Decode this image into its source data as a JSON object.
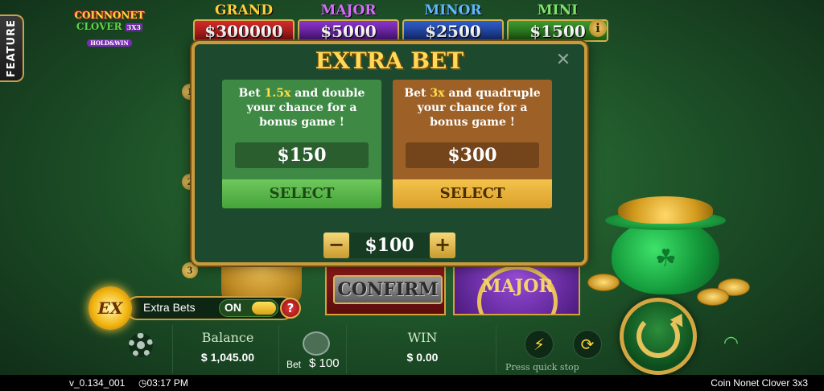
{
  "sidebar": {
    "feature_label": "FEATURE"
  },
  "logo": {
    "line1": "COINNONET",
    "line2": "CLOVER",
    "line2_badge": "3X3",
    "line3": "HOLD&WIN"
  },
  "jackpots": [
    {
      "name": "GRAND",
      "value": "$300000"
    },
    {
      "name": "MAJOR",
      "value": "$5000"
    },
    {
      "name": "MINOR",
      "value": "$2500"
    },
    {
      "name": "MINI",
      "value": "$1500"
    }
  ],
  "info_icon": "i",
  "rows": [
    "1",
    "2",
    "3"
  ],
  "modal": {
    "title": "EXTRA BET",
    "close": "✕",
    "options": [
      {
        "text_pre": "Bet ",
        "multiplier": "1.5x",
        "text_post": " and double your chance for a bonus game !",
        "price": "$150",
        "select_label": "SELECT",
        "color": "#3e8a45"
      },
      {
        "text_pre": "Bet ",
        "multiplier": "3x",
        "text_post": " and quadruple your chance for a bonus game !",
        "price": "$300",
        "select_label": "SELECT",
        "color": "#9d6128"
      }
    ],
    "stepper": {
      "minus": "−",
      "value": "$100",
      "plus": "+"
    }
  },
  "reels": {
    "major_symbol": "MAJOR",
    "confirm_label": "CONFIRM"
  },
  "extra_bets": {
    "badge": "EX",
    "label": "Extra Bets",
    "state": "ON",
    "help": "?"
  },
  "hud": {
    "balance_label": "Balance",
    "balance_value": "$ 1,045.00",
    "bet_label": "Bet",
    "bet_value": "$ 100",
    "win_label": "WIN",
    "win_value": "$ 0.00",
    "quick_stop_label": "Press quick stop"
  },
  "footer": {
    "version": "v_0.134_001",
    "time": "03:17 PM",
    "game_name": "Coin Nonet Clover 3x3"
  },
  "colors": {
    "accent_gold": "#c99b3e",
    "bg_green": "#1c4d26"
  }
}
